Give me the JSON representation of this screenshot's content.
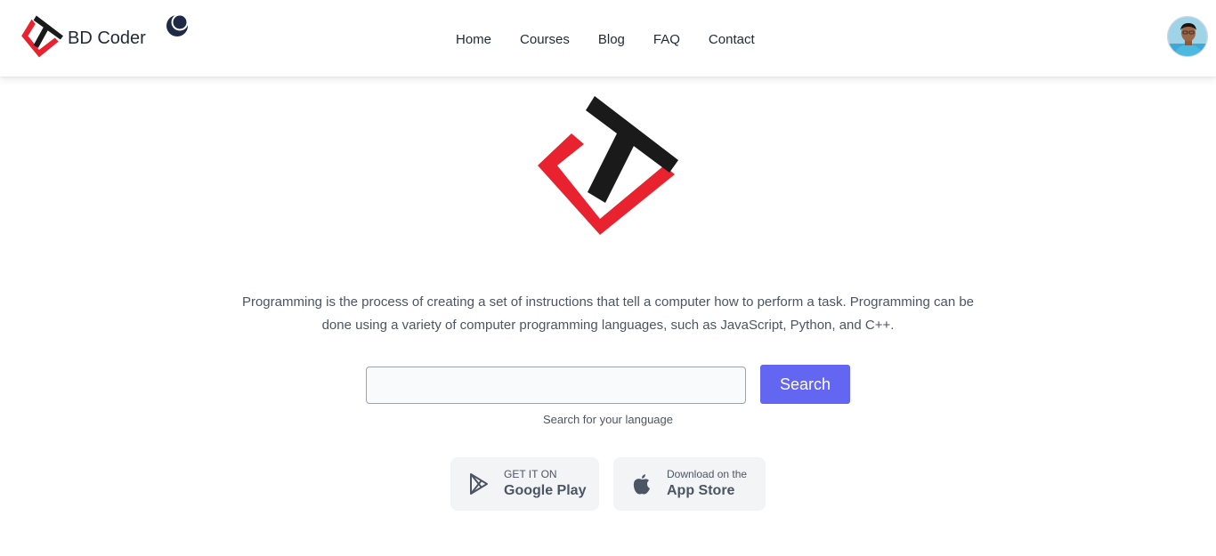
{
  "header": {
    "brand_name": "BD Coder",
    "theme_toggle_icon": "moon-icon",
    "nav": [
      {
        "label": "Home"
      },
      {
        "label": "Courses"
      },
      {
        "label": "Blog"
      },
      {
        "label": "FAQ"
      },
      {
        "label": "Contact"
      }
    ],
    "avatar_icon": "user-avatar"
  },
  "hero": {
    "logo_icon": "bd-coder-logo",
    "description": "Programming is the process of creating a set of instructions that tell a computer how to perform a task. Programming can be done using a variety of computer programming languages, such as JavaScript, Python, and C++."
  },
  "search": {
    "value": "",
    "placeholder": "",
    "button_label": "Search",
    "hint": "Search for your language"
  },
  "stores": {
    "google_play": {
      "small": "GET IT ON",
      "big": "Google Play",
      "icon": "google-play-icon"
    },
    "app_store": {
      "small": "Download on the",
      "big": "App Store",
      "icon": "apple-icon"
    }
  },
  "colors": {
    "accent": "#6366f1",
    "logo_red": "#e8232f",
    "logo_dark": "#1a1a1a",
    "store_bg": "#f3f4f6"
  }
}
